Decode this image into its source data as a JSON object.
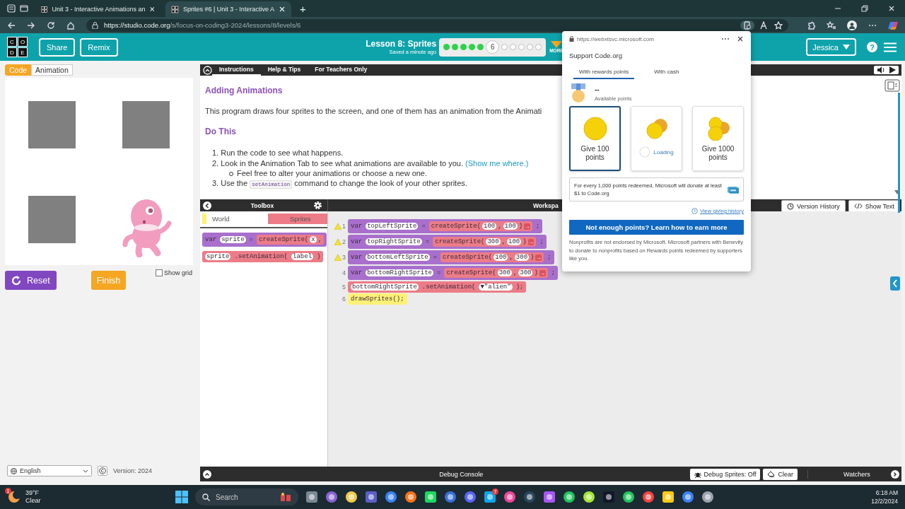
{
  "browser": {
    "tabs": [
      {
        "title": "Unit 3 - Interactive Animations an",
        "selected": false
      },
      {
        "title": "Sprites #6 | Unit 3 - Interactive A",
        "selected": true
      }
    ],
    "new_tab": "+",
    "address": {
      "host": "https://studio.code.org",
      "path": "/s/focus-on-coding3-2024/lessons/8/levels/6"
    }
  },
  "header": {
    "logo_letters": [
      "C",
      "O",
      "D",
      "E"
    ],
    "buttons": [
      "Share",
      "Remix"
    ],
    "lesson_title": "Lesson 8: Sprites",
    "saved": "Saved a minute ago",
    "progress": [
      {
        "completed": true,
        "selected": false
      },
      {
        "completed": true,
        "selected": false
      },
      {
        "completed": true,
        "selected": false
      },
      {
        "completed": true,
        "selected": false
      },
      {
        "completed": true,
        "selected": false
      },
      {
        "completed": false,
        "selected": true,
        "label": "6"
      },
      {
        "completed": false,
        "selected": false
      },
      {
        "completed": false,
        "selected": false
      },
      {
        "completed": false,
        "selected": false
      },
      {
        "completed": false,
        "selected": false
      },
      {
        "completed": false,
        "selected": false
      }
    ],
    "more": "MORE",
    "user": "Jessica",
    "help": "?"
  },
  "stage": {
    "view_tabs": [
      {
        "label": "Code",
        "selected": true
      },
      {
        "label": "Animation",
        "selected": false
      }
    ],
    "sprites": [
      {
        "kind": "box"
      },
      {
        "kind": "box"
      },
      {
        "kind": "box"
      },
      {
        "kind": "alien"
      }
    ],
    "reset": "Reset",
    "finish": "Finish",
    "show_grid": {
      "label": "Show grid",
      "checked": false
    },
    "language": "English",
    "version": "Version: 2024"
  },
  "instructions": {
    "tabs": [
      {
        "label": "Instructions",
        "selected": true
      },
      {
        "label": "Help & Tips",
        "selected": false
      },
      {
        "label": "For Teachers Only",
        "selected": false
      }
    ],
    "heading": "Adding Animations",
    "intro": "This program draws four sprites to the screen, and one of them has an animation from the Animati",
    "subheading": "Do This",
    "steps": [
      {
        "number": "1.",
        "parts": [
          {
            "kind": "text",
            "s": "Run the code to see what happens."
          }
        ]
      },
      {
        "number": "2.",
        "parts": [
          {
            "kind": "text",
            "s": "Look in the Animation Tab to see what animations are available to you. "
          },
          {
            "kind": "link",
            "s": "(Show me where.)"
          }
        ],
        "children": [
          {
            "text": "Feel free to alter your animations or choose a new one."
          }
        ]
      },
      {
        "number": "3.",
        "parts": [
          {
            "kind": "text",
            "s": "Use the "
          },
          {
            "kind": "code",
            "s": "setAnimation"
          },
          {
            "kind": "text",
            "s": " command to change the look of your other sprites."
          }
        ]
      }
    ]
  },
  "workspace": {
    "toolbox_title": "Toolbox",
    "workspace_title": "Workspa",
    "buttons": [
      "Version History",
      "Show Text"
    ],
    "categories": [
      {
        "label": "World",
        "selected": false,
        "color": "#fff176"
      },
      {
        "label": "Sprites",
        "selected": true,
        "color": "#ec7c87"
      }
    ],
    "toolbox_blocks": [
      {
        "kind": "var",
        "tokens": [
          {
            "kind": "text",
            "s": "var"
          },
          {
            "kind": "slot",
            "s": "sprite"
          },
          {
            "kind": "text",
            "s": "="
          },
          {
            "kind": "call",
            "tokens": [
              {
                "kind": "text",
                "s": "createSprite("
              },
              {
                "kind": "slot",
                "s": "x"
              },
              {
                "kind": "text",
                "s": ","
              }
            ]
          }
        ]
      },
      {
        "kind": "method",
        "tokens": [
          {
            "kind": "slot",
            "s": "sprite"
          },
          {
            "kind": "text",
            "s": ".setAnimation("
          },
          {
            "kind": "slot",
            "s": "label"
          },
          {
            "kind": "text",
            "s": ")"
          }
        ]
      }
    ],
    "lines": [
      {
        "number": "1",
        "warning": true,
        "kind": "var",
        "tokens": [
          {
            "kind": "text",
            "s": "var"
          },
          {
            "kind": "slot",
            "s": "topLeftSprite"
          },
          {
            "kind": "text",
            "s": "="
          },
          {
            "kind": "call",
            "tokens": [
              {
                "kind": "text",
                "s": "createSprite("
              },
              {
                "kind": "slot",
                "s": "100"
              },
              {
                "kind": "text",
                "s": ","
              },
              {
                "kind": "slot",
                "s": "100"
              },
              {
                "kind": "text",
                "s": ")"
              },
              {
                "kind": "arrow",
                "s": "→"
              }
            ]
          },
          {
            "kind": "text",
            "s": ";"
          }
        ]
      },
      {
        "number": "2",
        "warning": true,
        "kind": "var",
        "tokens": [
          {
            "kind": "text",
            "s": "var"
          },
          {
            "kind": "slot",
            "s": "topRightSprite"
          },
          {
            "kind": "text",
            "s": "="
          },
          {
            "kind": "call",
            "tokens": [
              {
                "kind": "text",
                "s": "createSprite("
              },
              {
                "kind": "slot",
                "s": "300"
              },
              {
                "kind": "text",
                "s": ","
              },
              {
                "kind": "slot",
                "s": "100"
              },
              {
                "kind": "text",
                "s": ")"
              },
              {
                "kind": "arrow",
                "s": "→"
              }
            ]
          },
          {
            "kind": "text",
            "s": ";"
          }
        ]
      },
      {
        "number": "3",
        "warning": true,
        "kind": "var",
        "tokens": [
          {
            "kind": "text",
            "s": "var"
          },
          {
            "kind": "slot",
            "s": "bottomLeftSprite"
          },
          {
            "kind": "text",
            "s": "="
          },
          {
            "kind": "call",
            "tokens": [
              {
                "kind": "text",
                "s": "createSprite("
              },
              {
                "kind": "slot",
                "s": "100"
              },
              {
                "kind": "text",
                "s": ","
              },
              {
                "kind": "slot",
                "s": "300"
              },
              {
                "kind": "text",
                "s": ")"
              },
              {
                "kind": "arrow",
                "s": "→"
              }
            ]
          },
          {
            "kind": "text",
            "s": ";"
          }
        ]
      },
      {
        "number": "4",
        "warning": false,
        "kind": "var",
        "tokens": [
          {
            "kind": "text",
            "s": "var"
          },
          {
            "kind": "slot",
            "s": "bottomRightSprite"
          },
          {
            "kind": "text",
            "s": "="
          },
          {
            "kind": "call",
            "tokens": [
              {
                "kind": "text",
                "s": "createSprite("
              },
              {
                "kind": "slot",
                "s": "300"
              },
              {
                "kind": "text",
                "s": ","
              },
              {
                "kind": "slot",
                "s": "300"
              },
              {
                "kind": "text",
                "s": ")"
              },
              {
                "kind": "arrow",
                "s": "→"
              }
            ]
          },
          {
            "kind": "text",
            "s": ";"
          }
        ]
      },
      {
        "number": "5",
        "warning": false,
        "kind": "method",
        "tokens": [
          {
            "kind": "slot",
            "s": "bottomRightSprite"
          },
          {
            "kind": "text",
            "s": ".setAnimation("
          },
          {
            "kind": "dropdown",
            "caret": "▼",
            "s": "\"alien\""
          },
          {
            "kind": "text",
            "s": ");"
          }
        ]
      },
      {
        "number": "6",
        "warning": false,
        "kind": "draw",
        "tokens": [
          {
            "kind": "text",
            "s": "drawSprites();"
          }
        ]
      }
    ]
  },
  "debug": {
    "title": "Debug Console",
    "buttons": [
      "Debug Sprites: Off",
      "Clear"
    ],
    "watchers": "Watchers"
  },
  "popup": {
    "url": "https://webxtsvc.microsoft.com",
    "title": "Support Code.org",
    "tabs": [
      {
        "label": "With rewards points",
        "selected": true
      },
      {
        "label": "With cash",
        "selected": false
      }
    ],
    "points": "--",
    "points_label": "Available points",
    "options": [
      {
        "kind": "give",
        "label": "Give 100 points",
        "selected": true
      },
      {
        "kind": "loading",
        "label": "Loading",
        "selected": false
      },
      {
        "kind": "give",
        "label": "Give 1000 points",
        "selected": false
      }
    ],
    "info": "For every 1,000 points redeemed, Microsoft will donate at least $1 to Code.org",
    "history": "View giving history",
    "cta": "Not enough points? Learn how to earn more",
    "disclaimer": "Nonprofits are not endorsed by Microsoft. Microsoft partners with Benevity to donate to nonprofits based on Rewards points redeemed by supporters like you."
  },
  "taskbar": {
    "weather_badge": "1",
    "temperature": "39°F",
    "condition": "Clear",
    "search": {
      "placeholder": "Search"
    },
    "chat_badge": "7",
    "time": "6:18 AM",
    "date": "12/2/2024"
  }
}
